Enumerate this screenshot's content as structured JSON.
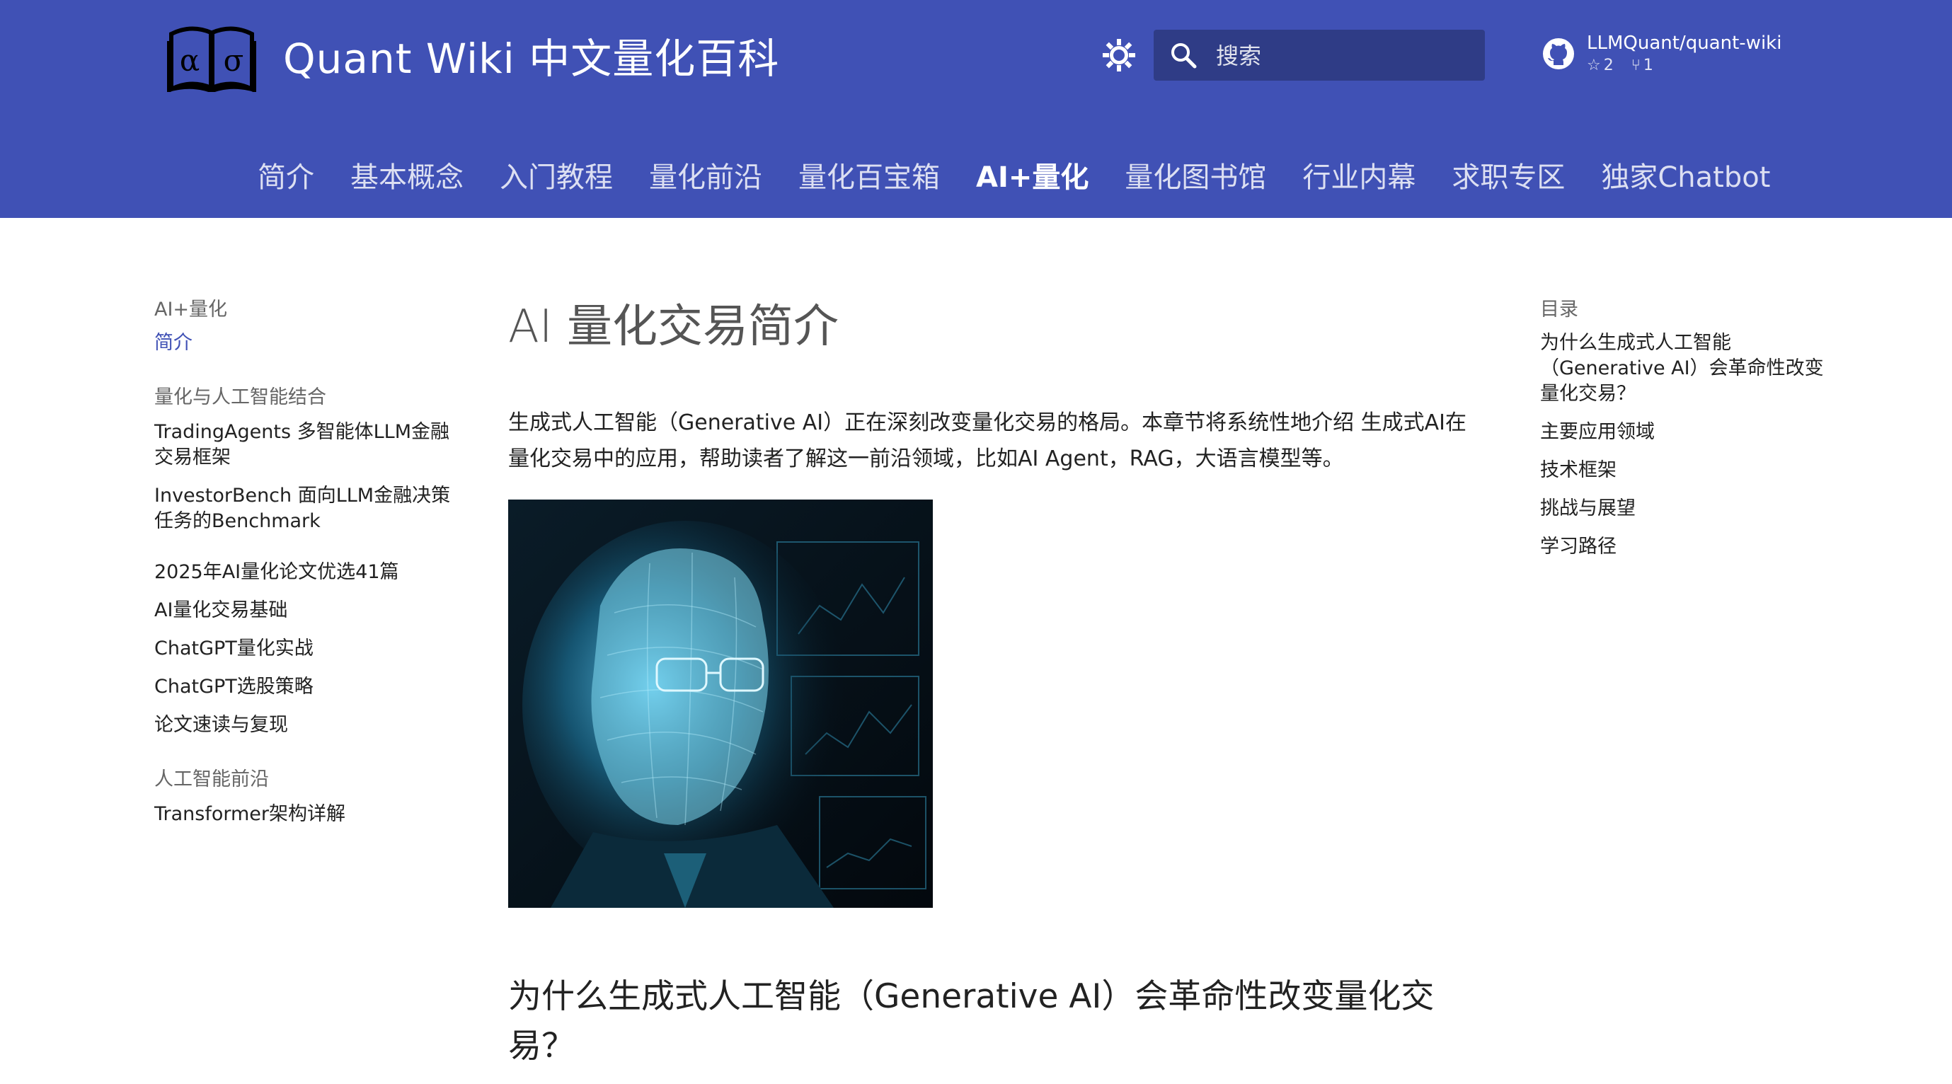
{
  "header": {
    "logo_text": "αδ",
    "site_title": "Quant Wiki 中文量化百科",
    "search_placeholder": "搜索",
    "repo": {
      "name": "LLMQuant/quant-wiki",
      "stars": "2",
      "forks": "1"
    }
  },
  "tabs": [
    {
      "label": "简介"
    },
    {
      "label": "基本概念"
    },
    {
      "label": "入门教程"
    },
    {
      "label": "量化前沿"
    },
    {
      "label": "量化百宝箱"
    },
    {
      "label": "AI+量化",
      "active": true
    },
    {
      "label": "量化图书馆"
    },
    {
      "label": "行业内幕"
    },
    {
      "label": "求职专区"
    },
    {
      "label": "独家Chatbot"
    }
  ],
  "nav": {
    "section_title": "AI+量化",
    "active_item": "简介",
    "group1_title": "量化与人工智能结合",
    "group1_items": [
      "TradingAgents 多智能体LLM金融交易框架",
      "InvestorBench 面向LLM金融决策任务的Benchmark"
    ],
    "items": [
      "2025年AI量化论文优选41篇",
      "AI量化交易基础",
      "ChatGPT量化实战",
      "ChatGPT选股策略",
      "论文速读与复现"
    ],
    "group2_title": "人工智能前沿",
    "group2_items": [
      "Transformer架构详解"
    ]
  },
  "content": {
    "title": "AI 量化交易简介",
    "intro": "生成式人工智能（Generative AI）正在深刻改变量化交易的格局。本章节将系统性地介绍 生成式AI在量化交易中的应用，帮助读者了解这一前沿领域，比如AI Agent，RAG，大语言模型等。",
    "h2": "为什么生成式人工智能（Generative AI）会革命性改变量化交易？"
  },
  "toc": {
    "title": "目录",
    "items": [
      "为什么生成式人工智能（Generative AI）会革命性改变量化交易？",
      "主要应用领域",
      "技术框架",
      "挑战与展望",
      "学习路径"
    ]
  },
  "colors": {
    "primary": "#4051b5",
    "accent_link": "#4051b5"
  }
}
